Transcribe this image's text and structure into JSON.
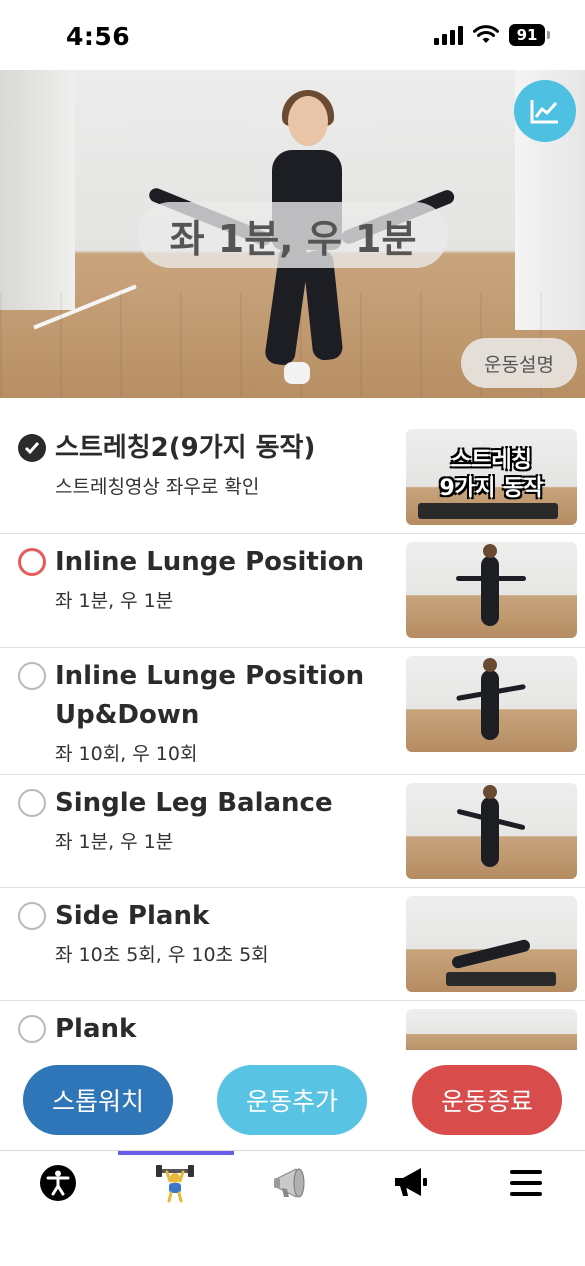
{
  "status_bar": {
    "time": "4:56",
    "battery": "91"
  },
  "hero": {
    "caption": "좌 1분, 우 1분",
    "description_button": "운동설명",
    "stats_icon": "chart-line-icon"
  },
  "exercises": [
    {
      "title": "스트레칭2(9가지 동작)",
      "subtitle": "스트레칭영상 좌우로 확인",
      "state": "done",
      "thumb_text": "스트레칭\n9가지 동작"
    },
    {
      "title": "Inline Lunge Position",
      "subtitle": "좌 1분, 우 1분",
      "state": "active"
    },
    {
      "title": "Inline Lunge Position",
      "title2": "Up&Down",
      "subtitle": "좌 10회, 우 10회",
      "state": "todo"
    },
    {
      "title": "Single Leg Balance",
      "subtitle": "좌 1분, 우 1분",
      "state": "todo"
    },
    {
      "title": "Side Plank",
      "subtitle": "좌 10초 5회, 우 10초 5회",
      "state": "todo"
    },
    {
      "title": "Plank",
      "state": "todo"
    }
  ],
  "actions": {
    "stopwatch": "스톱워치",
    "add": "운동추가",
    "end": "운동종료"
  },
  "tabbar": {
    "tabs": [
      "accessibility-icon",
      "weightlifter-icon",
      "megaphone-icon",
      "announcement-icon",
      "menu-icon"
    ],
    "active_index": 1
  },
  "colors": {
    "accent": "#4ec0e2",
    "stop": "#2f76b8",
    "end": "#d94c4c",
    "active_ring": "#e85b5b",
    "tab_indicator": "#6a5ee8"
  }
}
